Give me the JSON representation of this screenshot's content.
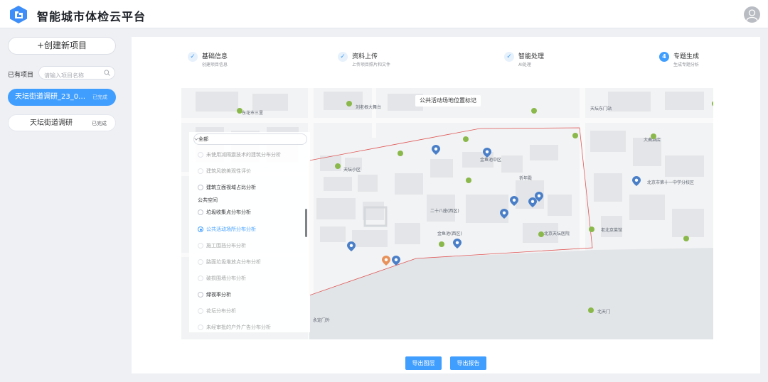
{
  "app": {
    "title": "智能城市体检云平台"
  },
  "sidebar": {
    "new_project_label": "+创建新项目",
    "existing_label": "已有项目",
    "search_placeholder": "请输入项目名称",
    "projects": [
      {
        "name": "天坛街道调研_23_09...",
        "status": "已完成",
        "active": true
      },
      {
        "name": "天坛街道调研",
        "status": "已完成",
        "active": false
      }
    ]
  },
  "steps": [
    {
      "index": "✓",
      "title": "基础信息",
      "desc": "创建项目信息",
      "done": true
    },
    {
      "index": "✓",
      "title": "资料上传",
      "desc": "上传项目照片和文件",
      "done": true
    },
    {
      "index": "✓",
      "title": "智能处理",
      "desc": "AI处理",
      "done": true
    },
    {
      "index": "4",
      "title": "专题生成",
      "desc": "生成专题分析",
      "done": false
    }
  ],
  "map": {
    "title": "公共活动场地位置标记",
    "labels": [
      "东花市三里",
      "天坛东门站",
      "刘老根大舞台",
      "北京市第十一中学分校区",
      "北天门",
      "大曲酒店",
      "老北京菜馆",
      "天坛小区",
      "祈年殿",
      "北京天坛医院",
      "二十八座(西区)",
      "金鱼池中区",
      "金鱼池(西区)",
      "永定门外"
    ]
  },
  "filter": {
    "selected": "全部",
    "group_title": "公共空间",
    "options_above": [
      {
        "label": "未使用减隔震技术的建筑分布分析"
      },
      {
        "label": "建筑风貌美观性评价"
      },
      {
        "label": "建筑立面视域占比分析"
      }
    ],
    "options": [
      {
        "label": "垃圾收集点分布分析",
        "checked": false,
        "faded": false
      },
      {
        "label": "公共活动场所分布分析",
        "checked": true,
        "faded": false
      },
      {
        "label": "施工围挡分布分析",
        "checked": false,
        "faded": true
      },
      {
        "label": "路面垃圾堆放点分布分析",
        "checked": false,
        "faded": true
      },
      {
        "label": "破损围墙分布分析",
        "checked": false,
        "faded": true
      },
      {
        "label": "绿视率分析",
        "checked": false,
        "faded": false
      },
      {
        "label": "花坛分布分析",
        "checked": false,
        "faded": true
      },
      {
        "label": "未经审批的户外广告分布分析",
        "checked": false,
        "faded": true
      }
    ]
  },
  "buttons": {
    "export_layer": "导出图层",
    "export_report": "导出报告"
  },
  "colors": {
    "accent": "#409eff",
    "poi_green": "#8ab84a",
    "boundary_red": "#e05656"
  }
}
